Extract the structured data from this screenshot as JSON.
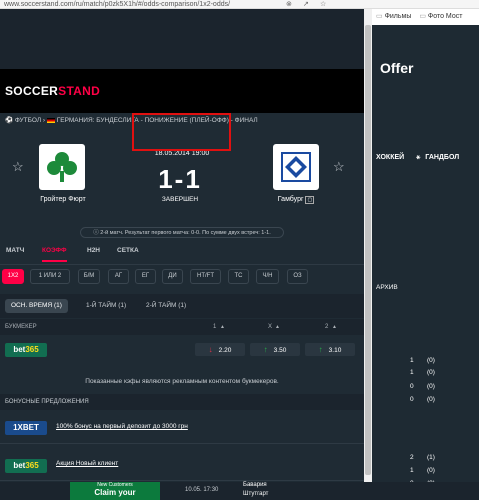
{
  "browser": {
    "url": "www.soccerstand.com/ru/match/p0zk5X1h/#/odds-comparison/1x2-odds/",
    "bookmarks": [
      "Фильмы",
      "Фото Мост"
    ]
  },
  "brand": {
    "part1": "SOCCER",
    "part2": "STAND"
  },
  "breadcrumb": {
    "sport": "ФУТБОЛ",
    "path": "ГЕРМАНИЯ: БУНДЕСЛИГА - ПОНИЖЕНИЕ (ПЛЕЙ-ОФФ) - ФИНАЛ"
  },
  "match": {
    "datetime": "18.05.2014 19:00",
    "home": "Гройтер Фюрт",
    "away": "Гамбург",
    "score": "1-1",
    "status": "ЗАВЕРШЕН",
    "info": "2-й матч. Результат первого матча: 0-0. По сумме двух встреч: 1-1."
  },
  "tabs": [
    "МАТЧ",
    "КОЭФФ",
    "Н2Н",
    "СЕТКА"
  ],
  "chips": [
    "1X2",
    "1 ИЛИ 2",
    "Б/М",
    "АГ",
    "ЕГ",
    "ДИ",
    "HT/FT",
    "ТС",
    "Ч/Н",
    "ОЗ"
  ],
  "periods": [
    "ОСН. ВРЕМЯ (1)",
    "1-Й ТАЙМ (1)",
    "2-Й ТАЙМ (1)"
  ],
  "columns": {
    "bookmaker": "БУКМЕКЕР",
    "c1": "1",
    "cx": "X",
    "c2": "2"
  },
  "odds_row": {
    "bookmaker": "bet365",
    "o1": "2.20",
    "ox": "3.50",
    "o2": "3.10"
  },
  "ad_note": "Показанные кэфы являются рекламным контентом букмекеров.",
  "bonus_header": "БОНУСНЫЕ ПРЕДЛОЖЕНИЯ",
  "promos": [
    {
      "bookmaker": "1XBET",
      "text": "100% бонус на первый депозит до 3000 грн"
    },
    {
      "bookmaker": "bet365",
      "text": "Акция Новый клиент"
    }
  ],
  "right": {
    "offer": "Offer",
    "sports": [
      "ХОККЕЙ",
      "ГАНДБОЛ"
    ],
    "archive": "АРХИВ",
    "rows": [
      [
        "1",
        "(0)"
      ],
      [
        "1",
        "(0)"
      ],
      [
        "0",
        "(0)"
      ],
      [
        "0",
        "(0)"
      ],
      [
        "2",
        "(1)"
      ],
      [
        "1",
        "(0)"
      ],
      [
        "0",
        "(0)"
      ]
    ]
  },
  "bottom": {
    "banner1": "New Customers",
    "banner2": "Claim your",
    "time": "10.05. 17:30",
    "team1": "Бавария",
    "team2": "Штутгарт"
  },
  "colors": {
    "accent": "#ff0046",
    "bg": "#1f2b34"
  }
}
